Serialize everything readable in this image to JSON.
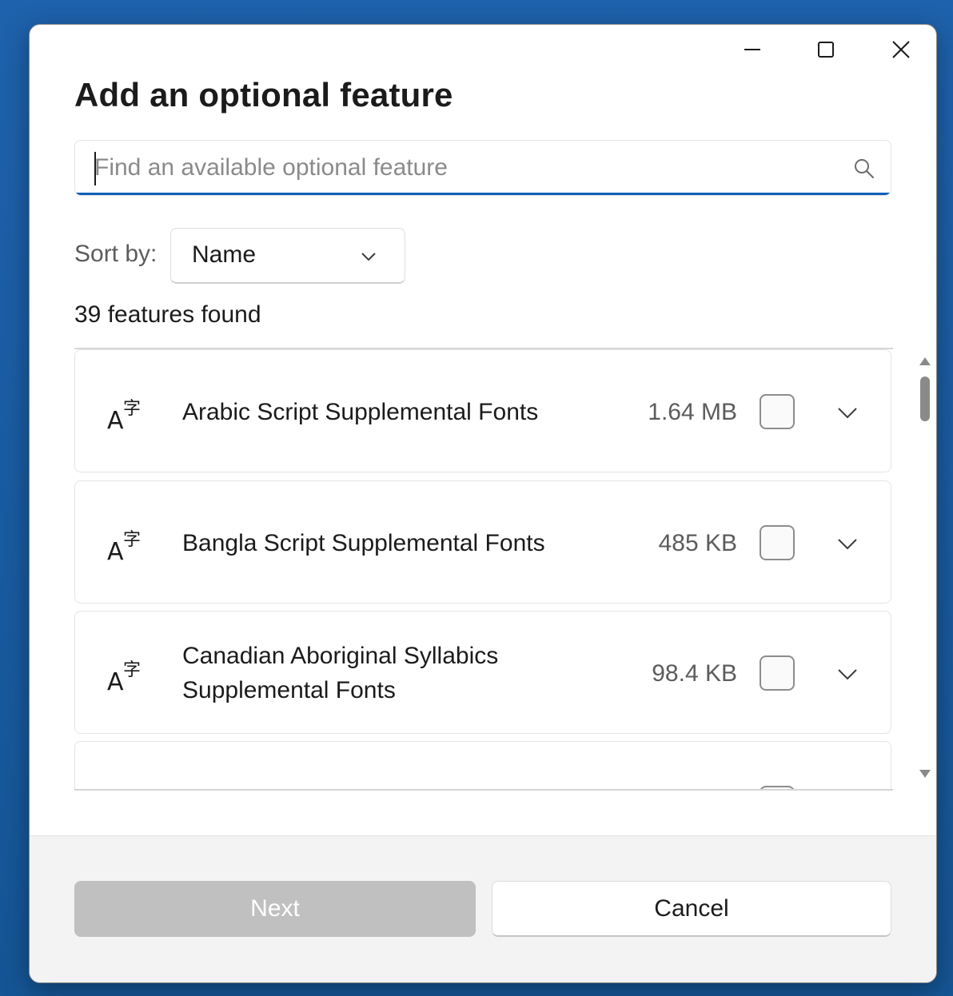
{
  "dialog": {
    "title": "Add an optional feature",
    "window_controls": {
      "minimize": "minimize-icon",
      "maximize": "maximize-icon",
      "close": "close-icon"
    }
  },
  "search": {
    "placeholder": "Find an available optional feature",
    "value": "",
    "icon": "search-icon",
    "accent_color": "#0a5eb8"
  },
  "sort": {
    "label": "Sort by:",
    "selected": "Name",
    "icon": "chevron-down-icon"
  },
  "results": {
    "count_text": "39 features found"
  },
  "features": [
    {
      "name": "Arabic Script Supplemental Fonts",
      "size": "1.64 MB",
      "checked": false,
      "icon": "font-language-icon"
    },
    {
      "name": "Bangla Script Supplemental Fonts",
      "size": "485 KB",
      "checked": false,
      "icon": "font-language-icon"
    },
    {
      "name": "Canadian Aboriginal Syllabics Supplemental Fonts",
      "size": "98.4 KB",
      "checked": false,
      "icon": "font-language-icon"
    },
    {
      "name": "",
      "size": "",
      "checked": false,
      "icon": "font-language-icon"
    }
  ],
  "footer": {
    "next_label": "Next",
    "cancel_label": "Cancel"
  }
}
